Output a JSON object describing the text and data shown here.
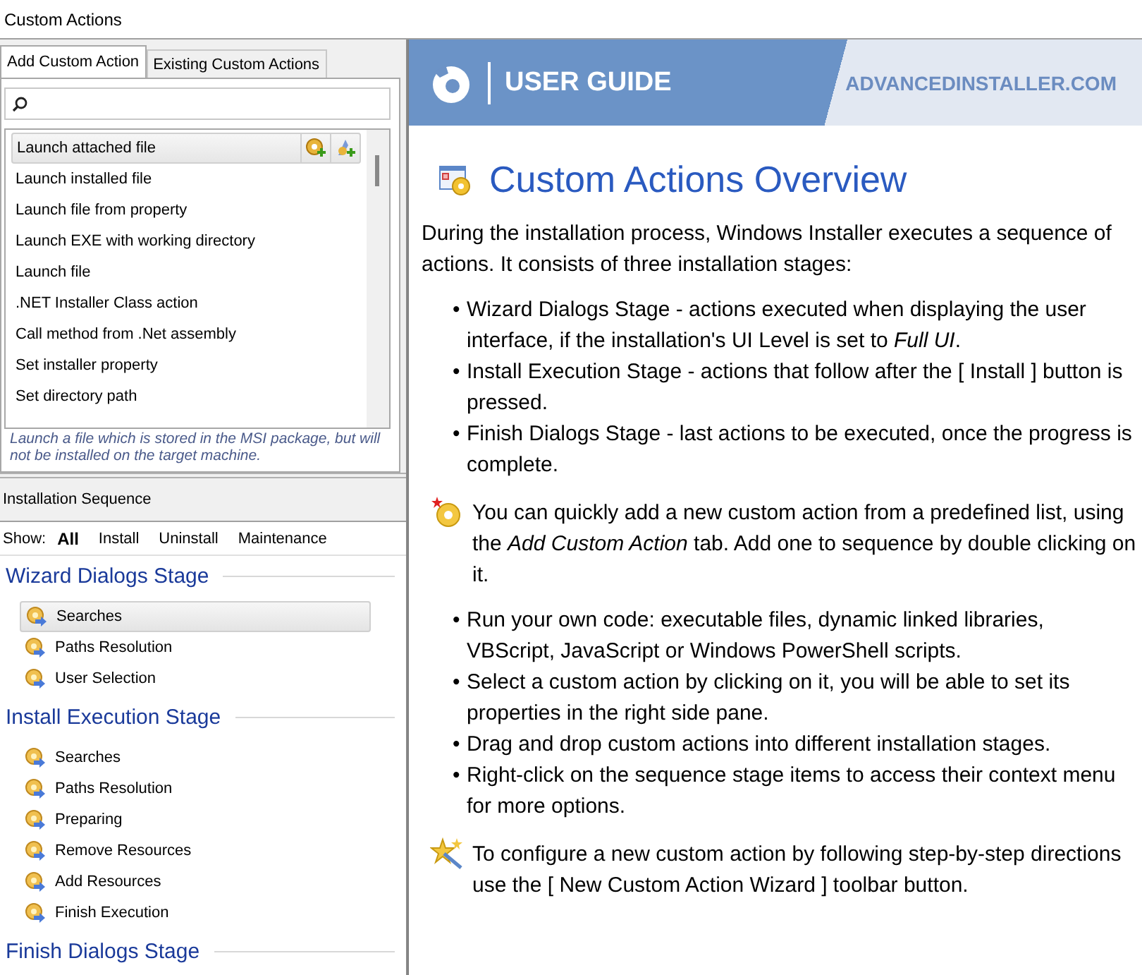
{
  "window": {
    "title": "Custom Actions"
  },
  "tabs": [
    {
      "label": "Add Custom Action",
      "selected": true
    },
    {
      "label": "Existing Custom Actions",
      "selected": false
    }
  ],
  "actions": [
    {
      "label": "Launch attached file",
      "selected": true
    },
    {
      "label": "Launch installed file",
      "selected": false
    },
    {
      "label": "Launch file from property",
      "selected": false
    },
    {
      "label": "Launch EXE with working directory",
      "selected": false
    },
    {
      "label": "Launch file",
      "selected": false
    },
    {
      "label": ".NET Installer Class action",
      "selected": false
    },
    {
      "label": "Call method from .Net assembly",
      "selected": false
    },
    {
      "label": "Set installer property",
      "selected": false
    },
    {
      "label": "Set directory path",
      "selected": false
    }
  ],
  "description": "Launch a file which is stored in the MSI package, but will not be installed on the target machine.",
  "sequence": {
    "title": "Installation Sequence",
    "show_label": "Show:",
    "filters": [
      {
        "label": "All",
        "selected": true
      },
      {
        "label": "Install",
        "selected": false
      },
      {
        "label": "Uninstall",
        "selected": false
      },
      {
        "label": "Maintenance",
        "selected": false
      }
    ],
    "stages": [
      {
        "title": "Wizard Dialogs Stage",
        "items": [
          {
            "label": "Searches",
            "selected": true
          },
          {
            "label": "Paths Resolution",
            "selected": false
          },
          {
            "label": "User Selection",
            "selected": false
          }
        ]
      },
      {
        "title": "Install Execution Stage",
        "items": [
          {
            "label": "Searches",
            "selected": false
          },
          {
            "label": "Paths Resolution",
            "selected": false
          },
          {
            "label": "Preparing",
            "selected": false
          },
          {
            "label": "Remove Resources",
            "selected": false
          },
          {
            "label": "Add Resources",
            "selected": false
          },
          {
            "label": "Finish Execution",
            "selected": false
          }
        ]
      },
      {
        "title": "Finish Dialogs Stage"
      }
    ]
  },
  "guide": {
    "banner": {
      "title": "USER GUIDE",
      "site": "ADVANCEDINSTALLER.COM"
    },
    "heading": "Custom Actions Overview",
    "intro": "During the installation process, Windows Installer executes a sequence of actions. It consists of three installation stages:",
    "stage_notes": [
      {
        "marker": "•",
        "text": "Wizard Dialogs Stage - actions executed when displaying the user interface, if the installation's UI Level is set to *Full UI*."
      },
      {
        "marker": "•",
        "text": "Install Execution Stage - actions that follow after the [ Install ] button is pressed."
      },
      {
        "marker": "•",
        "text": "Finish Dialogs Stage - last actions to be executed, once the progress is complete."
      }
    ],
    "tip": "You can quickly add a new custom action from a predefined list, using the *Add Custom Action* tab. Add one to sequence by double clicking on it.",
    "bullets": [
      {
        "marker": "•",
        "text": "Run your own code: executable files, dynamic linked libraries, VBScript, JavaScript or Windows PowerShell scripts."
      },
      {
        "marker": "•",
        "text": "Select a custom action by clicking on it, you will be able to set its properties in the right side pane."
      },
      {
        "marker": "•",
        "text": "Drag and drop custom actions into different installation stages."
      },
      {
        "marker": "•",
        "text": "Right-click on the sequence stage items to access their context menu for more options."
      }
    ],
    "wizard_tip": "To configure a new custom action by following step-by-step directions use the [ New Custom Action Wizard ] toolbar button."
  }
}
